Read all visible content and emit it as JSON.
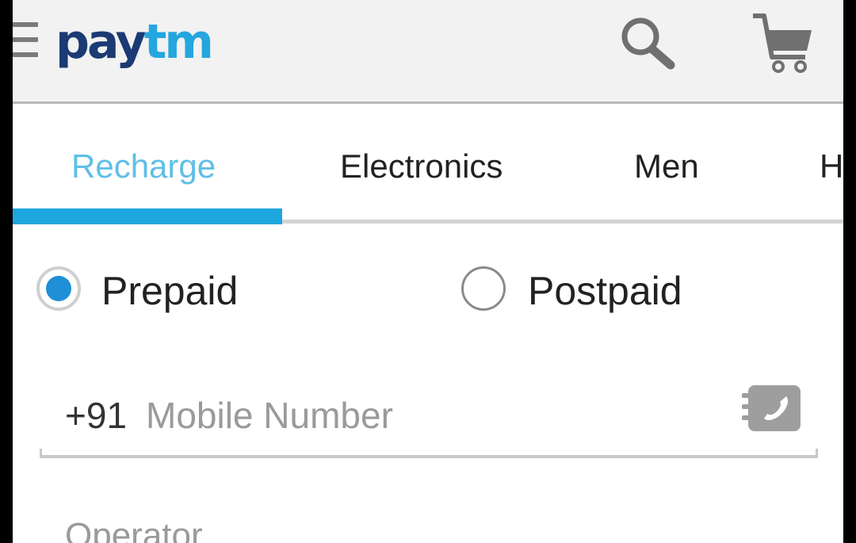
{
  "app": {
    "logo_part1": "pay",
    "logo_part2": "tm",
    "brand_dark": "#1c3a73",
    "brand_light": "#25a6df"
  },
  "header": {
    "icons": [
      "menu-icon",
      "search-icon",
      "cart-icon"
    ]
  },
  "tabs": [
    {
      "label": "Recharge",
      "active": true
    },
    {
      "label": "Electronics",
      "active": false
    },
    {
      "label": "Men",
      "active": false
    },
    {
      "label": "H",
      "active": false
    }
  ],
  "plan_type": {
    "options": [
      {
        "label": "Prepaid",
        "checked": true
      },
      {
        "label": "Postpaid",
        "checked": false
      }
    ]
  },
  "mobile": {
    "prefix": "+91",
    "placeholder": "Mobile Number",
    "value": "",
    "icon": "contact-book-icon"
  },
  "operator": {
    "placeholder": "Operator"
  },
  "colors": {
    "accent": "#1ea7de",
    "tab_active_text": "#5fbfe8",
    "radio_checked": "#1f8fd8"
  }
}
